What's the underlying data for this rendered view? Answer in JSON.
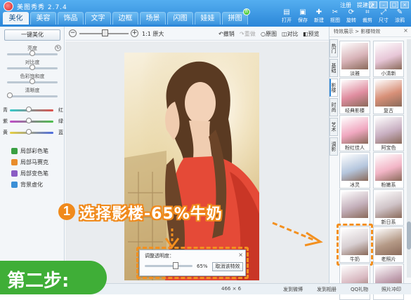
{
  "app": {
    "title": "美图秀秀 2.7.4"
  },
  "tabs": [
    {
      "label": "美化",
      "active": true
    },
    {
      "label": "美容"
    },
    {
      "label": "饰品"
    },
    {
      "label": "文字"
    },
    {
      "label": "边框"
    },
    {
      "label": "场景"
    },
    {
      "label": "闪图"
    },
    {
      "label": "娃娃"
    },
    {
      "label": "拼图",
      "badge": "新"
    }
  ],
  "top_links": {
    "register": "注册",
    "feedback": "提建议"
  },
  "toolbar": {
    "items": [
      {
        "label": "打开",
        "icon": "folder-icon"
      },
      {
        "label": "保存",
        "icon": "save-icon"
      },
      {
        "label": "新建",
        "icon": "new-icon"
      },
      {
        "label": "抠图",
        "icon": "cutout-icon"
      },
      {
        "label": "旋转",
        "icon": "rotate-icon"
      },
      {
        "label": "裁剪",
        "icon": "crop-icon"
      },
      {
        "label": "尺寸",
        "icon": "resize-icon"
      },
      {
        "label": "涂鸦",
        "icon": "brush-icon"
      },
      {
        "label": "撤销",
        "icon": "undo-icon"
      }
    ]
  },
  "left_panel": {
    "one_click": "一键美化",
    "adjustments": [
      {
        "label": "亮度",
        "value": 0.5
      },
      {
        "label": "对比度",
        "value": 0.5
      },
      {
        "label": "色彩饱和度",
        "value": 0.5
      },
      {
        "label": "清晰度",
        "value": 0.0
      }
    ],
    "color_balance": [
      {
        "left": "青",
        "right": "红",
        "colors": [
          "#33cccc",
          "#e0504c"
        ]
      },
      {
        "left": "紫",
        "right": "绿",
        "colors": [
          "#c04cc8",
          "#4cc04c"
        ]
      },
      {
        "left": "黄",
        "right": "蓝",
        "colors": [
          "#e8d040",
          "#4c6ce0"
        ]
      }
    ],
    "tools": [
      {
        "label": "局部彩色笔",
        "color": "#3aa043"
      },
      {
        "label": "局部马赛克",
        "color": "#e88d2c"
      },
      {
        "label": "局部变色笔",
        "color": "#8a5cc4"
      },
      {
        "label": "背景虚化",
        "color": "#3b8fd6"
      }
    ]
  },
  "center_bar": {
    "zoom_text": "1:1 原大",
    "buttons": [
      {
        "label": "↶撤销",
        "disabled": false
      },
      {
        "label": "↷重做",
        "disabled": true
      },
      {
        "label": "○原图",
        "disabled": false
      },
      {
        "label": "◫对比",
        "disabled": false
      },
      {
        "label": "◧预览",
        "disabled": false
      }
    ]
  },
  "right_panel": {
    "breadcrumb": "特效展示 > 影楼特效",
    "vtabs": [
      {
        "label": "热门"
      },
      {
        "label": "基础"
      },
      {
        "label": "影楼",
        "active": true
      },
      {
        "label": "时尚"
      },
      {
        "label": "艺术"
      },
      {
        "label": "调影"
      }
    ],
    "effects": [
      {
        "label": "淡雅",
        "tint": "#d8b3b8"
      },
      {
        "label": "小清新",
        "tint": "#e7c6d7"
      },
      {
        "label": "经典影楼",
        "tint": "#e08da0"
      },
      {
        "label": "复古",
        "tint": "#d89078"
      },
      {
        "label": "粉红佳人",
        "tint": "#f0a8c0"
      },
      {
        "label": "阿宝色",
        "tint": "#c9b0c2"
      },
      {
        "label": "冰灵",
        "tint": "#b5c6dd"
      },
      {
        "label": "粉嫩系",
        "tint": "#f2b5c6"
      },
      {
        "label": "",
        "tint": "#c4b0bb"
      },
      {
        "label": "新日系",
        "tint": "#cfc3c7"
      },
      {
        "label": "牛奶",
        "tint": "#d8cfd2",
        "selected": true
      },
      {
        "label": "老照片",
        "tint": "#b59a87"
      },
      {
        "label": "",
        "tint": "#d8b8c0"
      },
      {
        "label": "",
        "tint": "#c09faf"
      }
    ]
  },
  "dialog": {
    "title": "调整透明度：",
    "value_text": "65%",
    "value": 0.65,
    "cancel_label": "取消该特效"
  },
  "bottom_bar": {
    "items": [
      "发到微博",
      "发到相册",
      "QQ礼物",
      "照片冲印"
    ],
    "counter": "466 × 6"
  },
  "annotation": {
    "number": "1",
    "text": "选择影楼-65%牛奶",
    "step": "第二步:"
  },
  "colors": {
    "accent": "#2b86d8",
    "highlight": "#f3901f",
    "step_green": "#3fae37"
  }
}
